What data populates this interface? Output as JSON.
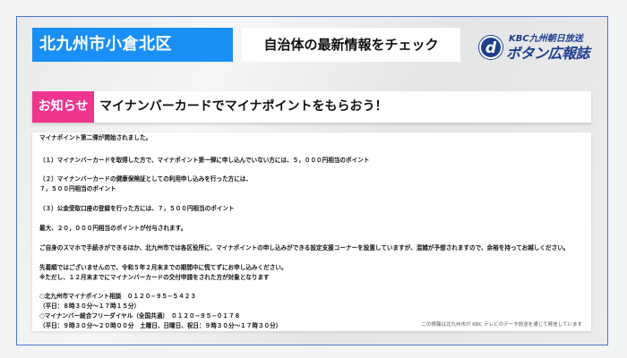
{
  "header": {
    "region": "北九州市小倉北区",
    "tagline": "自治体の最新情報をチェック",
    "logo": {
      "kbc": "KBC九州朝日放送",
      "d": "d",
      "name": "ボタン広報誌"
    }
  },
  "notice": {
    "badge": "お知らせ",
    "title": "マイナンバーカードでマイナポイントをもらおう！"
  },
  "content": {
    "lines": [
      "マイナポイント第二弾が開始されました。",
      "（１）マイナンバーカードを取得した方で、マイナポイント第一弾に申し込んでいない方には、５，０００円相当のポイント",
      "（２）マイナンバーカードの健康保険証としての利用申し込みを行った方には、",
      "７，５００円相当のポイント",
      "（３）公金受取口座の登録を行った方には、７，５００円相当のポイント",
      "最大、２０，０００円相当のポイントが付与されます。",
      "ご自身のスマホで手続きができるほか、北九州市では各区役所に、マイナポイントの申し込みができる設定支援コーナーを設置していますが、混雑が予想されますので、余裕を持ってお越しください。",
      "先着順ではございませんので、令和５年２月末までの期間中に慌てずにお申し込みください。",
      "※ただし、１２月末までにマイナンバーカードの交付申請をされた方が対象となります",
      "○北九州市マイナポイント相談　０１２０−９５−５４２３",
      "（平日：８時３０分〜１７時１５分）",
      "○マイナンバー総合フリーダイヤル（全国共通）　０１２０−９５−０１７８",
      "（平日：９時３０分〜２０時００分　土曜日、日曜日、祝日：９時３０分〜１７時３０分）"
    ],
    "footer": "この情報は北九州市が KBC テレビのデータ放送を通じて発信しています"
  }
}
